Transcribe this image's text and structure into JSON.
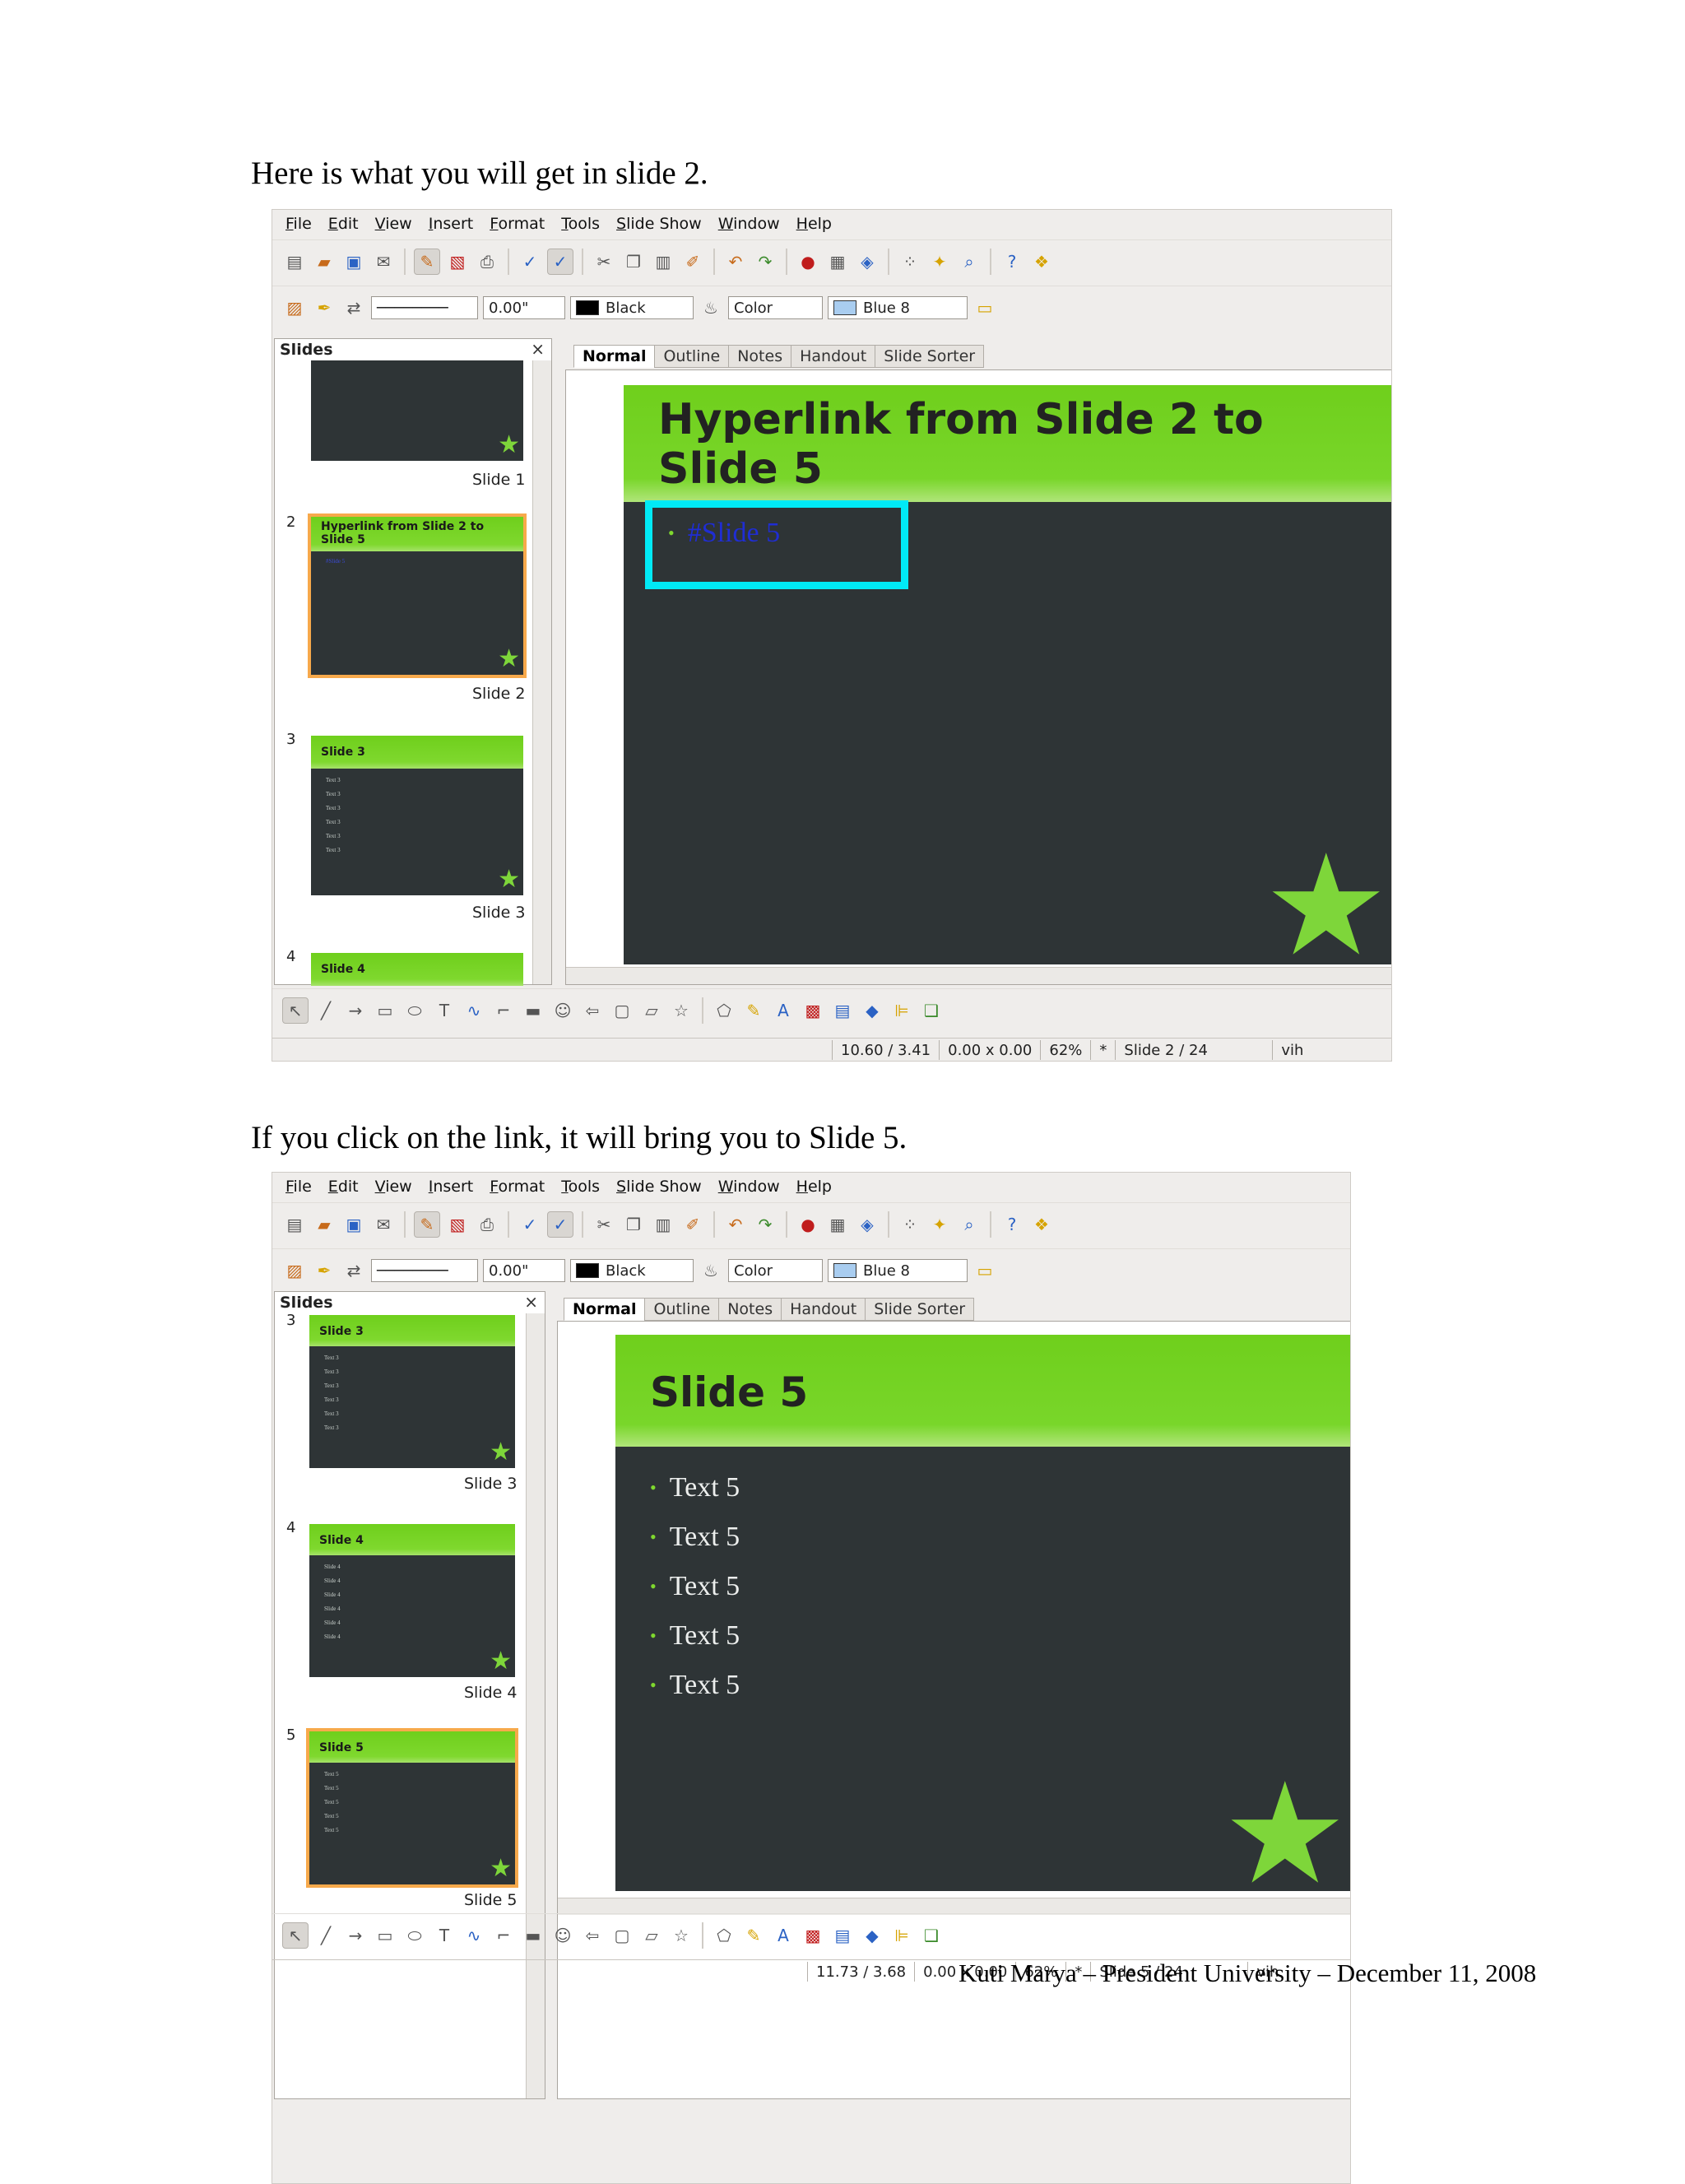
{
  "caption1": "Here is what you will get in slide 2.",
  "caption2": "If you click on the link, it will bring you to Slide 5.",
  "menu": [
    "File",
    "Edit",
    "View",
    "Insert",
    "Format",
    "Tools",
    "Slide Show",
    "Window",
    "Help"
  ],
  "toolbar2": {
    "line_width": "0.00\"",
    "line_color": "Black",
    "area_style": "Color",
    "area_color": "Blue 8"
  },
  "panel_title": "Slides",
  "panel_close": "×",
  "view_tabs": [
    "Normal",
    "Outline",
    "Notes",
    "Handout",
    "Slide Sorter"
  ],
  "shot1": {
    "thumbs": [
      {
        "num": "",
        "label": "Slide 1",
        "title": ""
      },
      {
        "num": "2",
        "label": "Slide 2",
        "title": "Hyperlink from Slide 2 to Slide 5",
        "link": "#Slide 5"
      },
      {
        "num": "3",
        "label": "Slide 3",
        "title": "Slide 3",
        "lines": [
          "Text 3",
          "Text 3",
          "Text 3",
          "Text 3",
          "Text 3",
          "Text 3"
        ]
      },
      {
        "num": "4",
        "label": "",
        "title": "Slide 4"
      }
    ],
    "slide_title_line1": "Hyperlink from Slide 2 to",
    "slide_title_line2": "Slide 5",
    "link_text": "#Slide 5",
    "status": {
      "position": "10.60 / 3.41",
      "size": "0.00 x 0.00",
      "zoom": "62%",
      "modified": "*",
      "page": "Slide 2 / 24",
      "layout": "vih"
    }
  },
  "shot2": {
    "thumbs": [
      {
        "num": "3",
        "label": "Slide 3",
        "title": "Slide 3",
        "lines": [
          "Text 3",
          "Text 3",
          "Text 3",
          "Text 3",
          "Text 3",
          "Text 3"
        ]
      },
      {
        "num": "4",
        "label": "Slide 4",
        "title": "Slide 4",
        "lines": [
          "Slide 4",
          "Slide 4",
          "Slide 4",
          "Slide 4",
          "Slide 4",
          "Slide 4"
        ]
      },
      {
        "num": "5",
        "label": "Slide 5",
        "title": "Slide 5",
        "lines": [
          "Text 5",
          "Text 5",
          "Text 5",
          "Text 5",
          "Text 5"
        ]
      }
    ],
    "slide_title": "Slide 5",
    "bullets": [
      "Text 5",
      "Text 5",
      "Text 5",
      "Text 5",
      "Text 5"
    ],
    "status": {
      "position": "11.73 / 3.68",
      "size": "0.00 x 0.00",
      "zoom": "62%",
      "modified": "*",
      "page": "Slide 5 / 24",
      "layout": "vih"
    }
  },
  "footer": "Kuti Marya – President University – December 11, 2008"
}
